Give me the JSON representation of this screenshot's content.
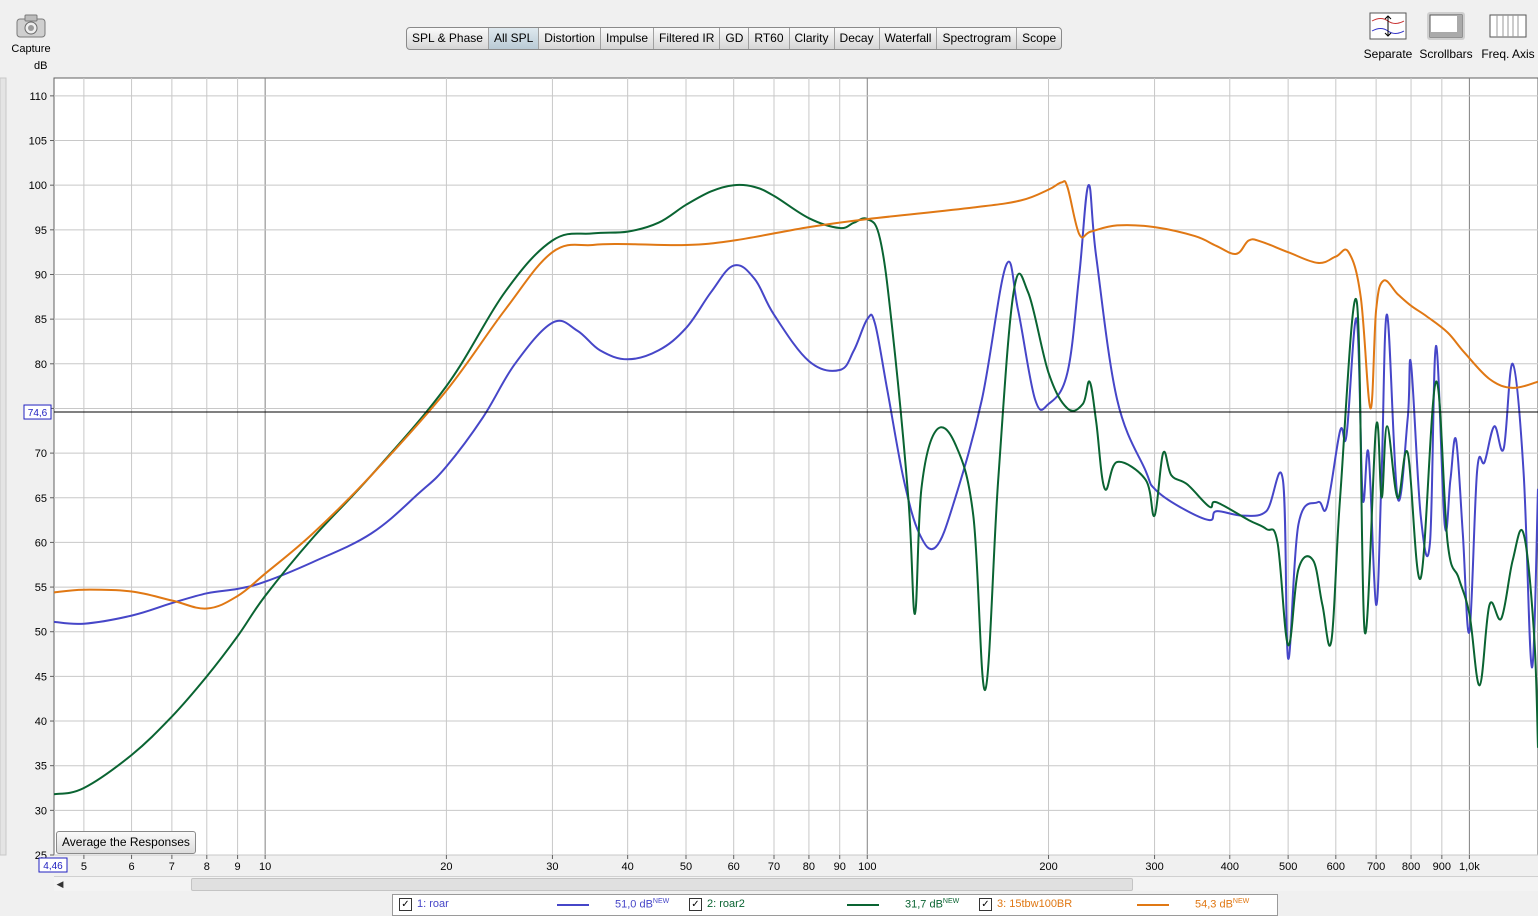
{
  "toolbar": {
    "capture_label": "Capture",
    "tabs": [
      {
        "label": "SPL & Phase",
        "active": false
      },
      {
        "label": "All SPL",
        "active": true
      },
      {
        "label": "Distortion",
        "active": false
      },
      {
        "label": "Impulse",
        "active": false
      },
      {
        "label": "Filtered IR",
        "active": false
      },
      {
        "label": "GD",
        "active": false
      },
      {
        "label": "RT60",
        "active": false
      },
      {
        "label": "Clarity",
        "active": false
      },
      {
        "label": "Decay",
        "active": false
      },
      {
        "label": "Waterfall",
        "active": false
      },
      {
        "label": "Spectrogram",
        "active": false
      },
      {
        "label": "Scope",
        "active": false
      }
    ],
    "separate_label": "Separate",
    "scrollbars_label": "Scrollbars",
    "freq_axis_label": "Freq. Axis"
  },
  "plot": {
    "y_unit": "dB",
    "cursor_y_label": "74,6",
    "cursor_x_label": "4,46",
    "average_button": "Average the Responses"
  },
  "legend": [
    {
      "name": "1: roar",
      "value": "51,0 dB",
      "badge": "NEW",
      "color": "#4646c8",
      "checked": true
    },
    {
      "name": "2: roar2",
      "value": "31,7 dB",
      "badge": "NEW",
      "color": "#0a6432",
      "checked": true
    },
    {
      "name": "3: 15tbw100BR",
      "value": "54,3 dB",
      "badge": "NEW",
      "color": "#e07814",
      "checked": true
    }
  ],
  "colors": {
    "series1": "#4646c8",
    "series2": "#0a6432",
    "series3": "#e07814",
    "grid": "#c8c8c8",
    "grid_major": "#808080",
    "background": "#ffffff"
  },
  "chart_data": {
    "type": "line",
    "title": "",
    "xlabel": "",
    "ylabel": "dB",
    "x_scale": "log",
    "xlim": [
      4.46,
      1300
    ],
    "ylim": [
      25,
      112
    ],
    "cursor_y": 74.6,
    "grid": true,
    "x_tick_labels": [
      "5",
      "6",
      "7",
      "8",
      "9",
      "10",
      "20",
      "30",
      "40",
      "50",
      "60",
      "70",
      "80",
      "90",
      "100",
      "200",
      "300",
      "400",
      "500",
      "600",
      "700",
      "800",
      "900",
      "1,0k"
    ],
    "x_tick_values": [
      5,
      6,
      7,
      8,
      9,
      10,
      20,
      30,
      40,
      50,
      60,
      70,
      80,
      90,
      100,
      200,
      300,
      400,
      500,
      600,
      700,
      800,
      900,
      1000
    ],
    "y_ticks": [
      25,
      30,
      35,
      40,
      45,
      50,
      55,
      60,
      65,
      70,
      75,
      80,
      85,
      90,
      95,
      100,
      105,
      110
    ],
    "series": [
      {
        "name": "1: roar",
        "points": [
          [
            4.46,
            51.1
          ],
          [
            5,
            50.9
          ],
          [
            6,
            51.8
          ],
          [
            7,
            53.2
          ],
          [
            8,
            54.3
          ],
          [
            9,
            54.8
          ],
          [
            10,
            55.6
          ],
          [
            12,
            57.8
          ],
          [
            15,
            61
          ],
          [
            18,
            65.5
          ],
          [
            20,
            68.5
          ],
          [
            23,
            74
          ],
          [
            26,
            80
          ],
          [
            30,
            84.6
          ],
          [
            33,
            83.7
          ],
          [
            36,
            81.5
          ],
          [
            40,
            80.5
          ],
          [
            45,
            81.5
          ],
          [
            50,
            84
          ],
          [
            55,
            88
          ],
          [
            60,
            91
          ],
          [
            65,
            89.5
          ],
          [
            70,
            85.5
          ],
          [
            80,
            80.3
          ],
          [
            90,
            79.3
          ],
          [
            95,
            81.5
          ],
          [
            100,
            85
          ],
          [
            103,
            84.5
          ],
          [
            108,
            77
          ],
          [
            115,
            67
          ],
          [
            122,
            61
          ],
          [
            130,
            59.5
          ],
          [
            140,
            65
          ],
          [
            155,
            76
          ],
          [
            170,
            91
          ],
          [
            178,
            86
          ],
          [
            190,
            76
          ],
          [
            200,
            75.5
          ],
          [
            215,
            79
          ],
          [
            225,
            90
          ],
          [
            233,
            100
          ],
          [
            240,
            92
          ],
          [
            260,
            76
          ],
          [
            290,
            68
          ],
          [
            300,
            66
          ],
          [
            330,
            64
          ],
          [
            370,
            62.5
          ],
          [
            380,
            63.5
          ],
          [
            420,
            63
          ],
          [
            460,
            63.5
          ],
          [
            490,
            67
          ],
          [
            500,
            47
          ],
          [
            520,
            62
          ],
          [
            560,
            64.5
          ],
          [
            580,
            64
          ],
          [
            610,
            72.5
          ],
          [
            625,
            72
          ],
          [
            650,
            85
          ],
          [
            665,
            65
          ],
          [
            680,
            70
          ],
          [
            700,
            53
          ],
          [
            715,
            68
          ],
          [
            730,
            85.5
          ],
          [
            760,
            65
          ],
          [
            790,
            74
          ],
          [
            800,
            80
          ],
          [
            830,
            63
          ],
          [
            860,
            60
          ],
          [
            880,
            82
          ],
          [
            910,
            62
          ],
          [
            930,
            67
          ],
          [
            950,
            71.5
          ],
          [
            975,
            61
          ],
          [
            1000,
            50
          ],
          [
            1030,
            68
          ],
          [
            1060,
            69
          ],
          [
            1100,
            73
          ],
          [
            1140,
            70.5
          ],
          [
            1180,
            80
          ],
          [
            1230,
            68
          ],
          [
            1270,
            46
          ],
          [
            1300,
            66
          ]
        ]
      },
      {
        "name": "2: roar2",
        "points": [
          [
            4.46,
            31.8
          ],
          [
            5,
            32.5
          ],
          [
            6,
            36.2
          ],
          [
            7,
            40.5
          ],
          [
            8,
            45
          ],
          [
            9,
            49.5
          ],
          [
            10,
            54
          ],
          [
            12,
            60.5
          ],
          [
            15,
            67.5
          ],
          [
            20,
            77.5
          ],
          [
            25,
            88
          ],
          [
            30,
            93.8
          ],
          [
            35,
            94.6
          ],
          [
            40,
            94.8
          ],
          [
            45,
            95.8
          ],
          [
            50,
            97.8
          ],
          [
            55,
            99.3
          ],
          [
            60,
            100
          ],
          [
            65,
            99.8
          ],
          [
            70,
            98.8
          ],
          [
            80,
            96.3
          ],
          [
            90,
            95.2
          ],
          [
            95,
            95.8
          ],
          [
            100,
            96.2
          ],
          [
            105,
            94
          ],
          [
            110,
            84
          ],
          [
            117,
            65
          ],
          [
            120,
            52
          ],
          [
            123,
            66
          ],
          [
            130,
            72.5
          ],
          [
            140,
            71
          ],
          [
            150,
            63
          ],
          [
            157,
            43.5
          ],
          [
            165,
            67
          ],
          [
            175,
            88
          ],
          [
            185,
            88
          ],
          [
            200,
            79
          ],
          [
            215,
            75
          ],
          [
            228,
            75.5
          ],
          [
            234,
            78
          ],
          [
            240,
            73.5
          ],
          [
            248,
            66
          ],
          [
            260,
            69
          ],
          [
            290,
            67
          ],
          [
            300,
            63
          ],
          [
            310,
            70
          ],
          [
            320,
            67.5
          ],
          [
            340,
            66.5
          ],
          [
            370,
            64
          ],
          [
            380,
            64.5
          ],
          [
            430,
            62.5
          ],
          [
            460,
            61.5
          ],
          [
            480,
            60
          ],
          [
            500,
            48.5
          ],
          [
            520,
            57
          ],
          [
            550,
            58
          ],
          [
            570,
            53
          ],
          [
            590,
            49
          ],
          [
            610,
            65
          ],
          [
            650,
            87
          ],
          [
            670,
            50
          ],
          [
            700,
            73
          ],
          [
            715,
            65
          ],
          [
            730,
            73
          ],
          [
            760,
            65
          ],
          [
            790,
            70
          ],
          [
            830,
            56
          ],
          [
            880,
            78
          ],
          [
            920,
            60
          ],
          [
            960,
            56
          ],
          [
            1000,
            52
          ],
          [
            1040,
            44
          ],
          [
            1080,
            53
          ],
          [
            1130,
            51.5
          ],
          [
            1180,
            58
          ],
          [
            1230,
            61
          ],
          [
            1280,
            50
          ],
          [
            1300,
            37
          ]
        ]
      },
      {
        "name": "3: 15tbw100BR",
        "points": [
          [
            4.46,
            54.4
          ],
          [
            5,
            54.7
          ],
          [
            6,
            54.5
          ],
          [
            7,
            53.5
          ],
          [
            8,
            52.6
          ],
          [
            9,
            54
          ],
          [
            10,
            56.5
          ],
          [
            12,
            61
          ],
          [
            15,
            67.5
          ],
          [
            20,
            77
          ],
          [
            25,
            86
          ],
          [
            30,
            92.5
          ],
          [
            35,
            93.3
          ],
          [
            40,
            93.4
          ],
          [
            50,
            93.3
          ],
          [
            60,
            93.8
          ],
          [
            80,
            95.3
          ],
          [
            100,
            96.2
          ],
          [
            150,
            97.5
          ],
          [
            180,
            98.3
          ],
          [
            200,
            99.5
          ],
          [
            210,
            100.3
          ],
          [
            215,
            99.8
          ],
          [
            225,
            94.5
          ],
          [
            235,
            94.8
          ],
          [
            260,
            95.5
          ],
          [
            300,
            95.3
          ],
          [
            350,
            94.3
          ],
          [
            380,
            93.2
          ],
          [
            410,
            92.3
          ],
          [
            430,
            93.8
          ],
          [
            450,
            93.7
          ],
          [
            500,
            92.5
          ],
          [
            560,
            91.3
          ],
          [
            600,
            92
          ],
          [
            630,
            92.5
          ],
          [
            660,
            87.5
          ],
          [
            685,
            75
          ],
          [
            700,
            86
          ],
          [
            720,
            89.3
          ],
          [
            760,
            87.8
          ],
          [
            800,
            86.5
          ],
          [
            850,
            85.3
          ],
          [
            920,
            83.5
          ],
          [
            980,
            81.3
          ],
          [
            1080,
            78.3
          ],
          [
            1180,
            77.3
          ],
          [
            1300,
            78
          ]
        ]
      }
    ]
  }
}
